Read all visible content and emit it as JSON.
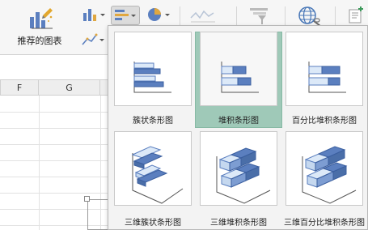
{
  "ribbon": {
    "recommended_label": "推荐的图表"
  },
  "grid": {
    "columns": [
      "F",
      "G"
    ]
  },
  "bar_menu": {
    "options": [
      {
        "label": "簇状条形图"
      },
      {
        "label": "堆积条形图",
        "selected": true
      },
      {
        "label": "百分比堆积条形图"
      },
      {
        "label": "三维簇状条形图"
      },
      {
        "label": "三维堆积条形图"
      },
      {
        "label": "三维百分比堆积条形图"
      }
    ]
  },
  "colors": {
    "bar_dark": "#5b7fbf",
    "bar_light": "#dce9f8",
    "selected_frame": "#9fc9b8"
  }
}
